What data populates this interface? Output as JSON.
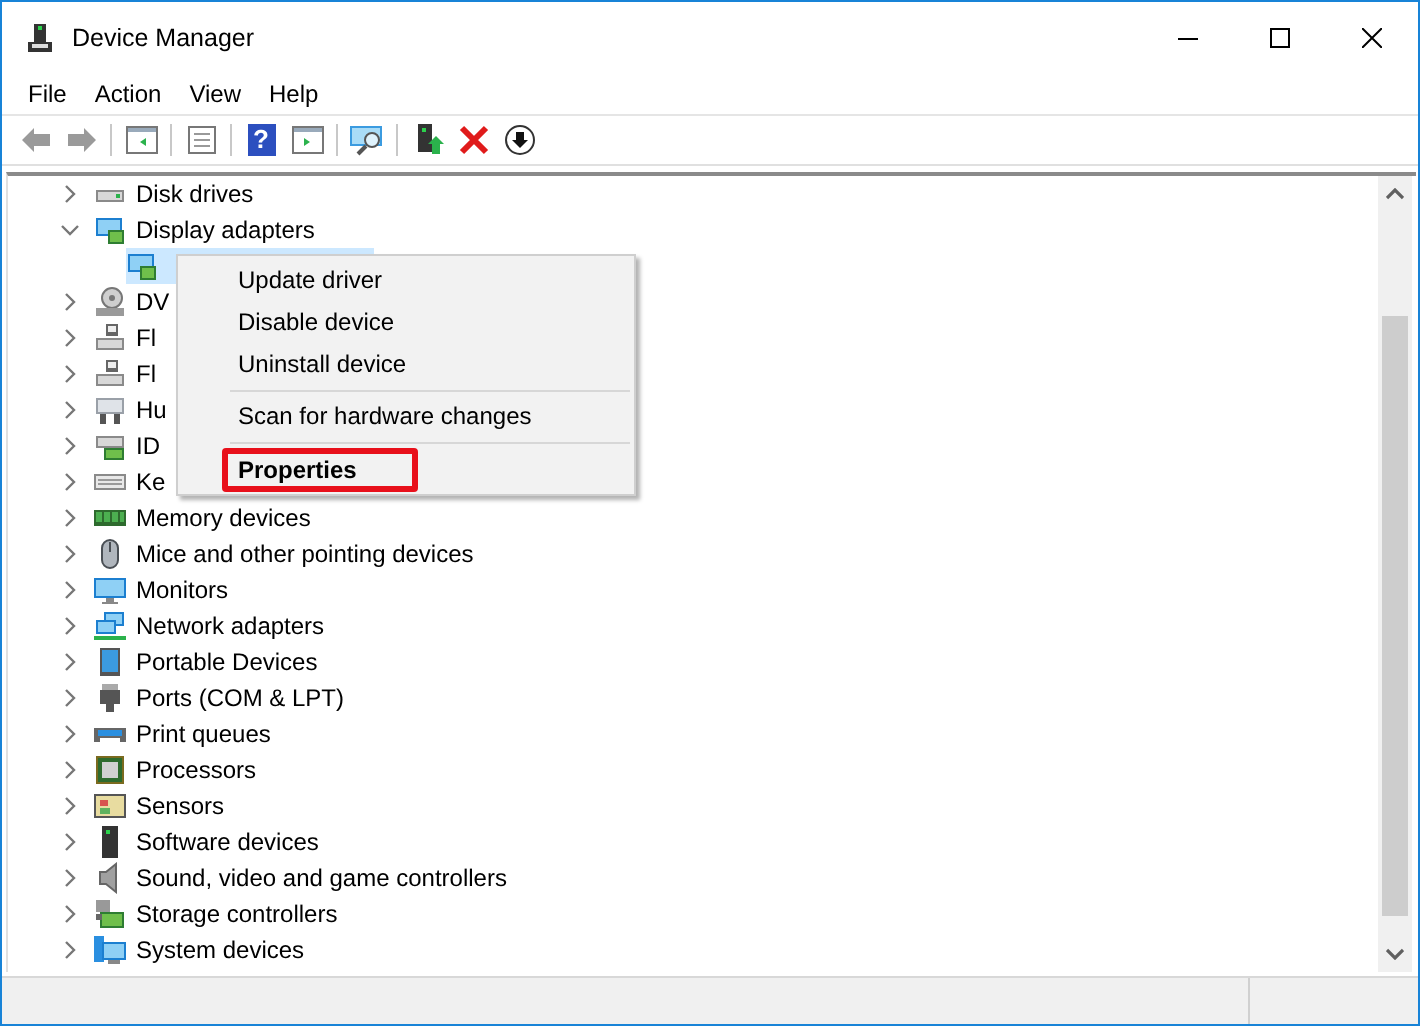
{
  "window": {
    "title": "Device Manager"
  },
  "menu_bar": [
    "File",
    "Action",
    "View",
    "Help"
  ],
  "toolbar": [
    {
      "kind": "back"
    },
    {
      "kind": "forward"
    },
    {
      "kind": "separator"
    },
    {
      "kind": "panel"
    },
    {
      "kind": "separator"
    },
    {
      "kind": "sheet"
    },
    {
      "kind": "separator"
    },
    {
      "kind": "help",
      "glyph": "?"
    },
    {
      "kind": "panel-play"
    },
    {
      "kind": "separator"
    },
    {
      "kind": "scan"
    },
    {
      "kind": "separator"
    },
    {
      "kind": "update"
    },
    {
      "kind": "remove"
    },
    {
      "kind": "down"
    }
  ],
  "tree": {
    "items": [
      {
        "label": "Disk drives",
        "expanded": false,
        "selected": false
      },
      {
        "label": "Display adapters",
        "expanded": true,
        "selected": false,
        "children": [
          {
            "selected": true
          }
        ]
      },
      {
        "label": "DV",
        "expanded": false,
        "selected": false
      },
      {
        "label": "Fl",
        "expanded": false,
        "selected": false
      },
      {
        "label": "Fl",
        "expanded": false,
        "selected": false
      },
      {
        "label": "Hu",
        "expanded": false,
        "selected": false
      },
      {
        "label": "ID",
        "expanded": false,
        "selected": false
      },
      {
        "label": "Ke",
        "expanded": false,
        "selected": false
      },
      {
        "label": "Memory devices",
        "expanded": false,
        "selected": false
      },
      {
        "label": "Mice and other pointing devices",
        "expanded": false,
        "selected": false
      },
      {
        "label": "Monitors",
        "expanded": false,
        "selected": false
      },
      {
        "label": "Network adapters",
        "expanded": false,
        "selected": false
      },
      {
        "label": "Portable Devices",
        "expanded": false,
        "selected": false
      },
      {
        "label": "Ports (COM & LPT)",
        "expanded": false,
        "selected": false
      },
      {
        "label": "Print queues",
        "expanded": false,
        "selected": false
      },
      {
        "label": "Processors",
        "expanded": false,
        "selected": false
      },
      {
        "label": "Sensors",
        "expanded": false,
        "selected": false
      },
      {
        "label": "Software devices",
        "expanded": false,
        "selected": false
      },
      {
        "label": "Sound, video and game controllers",
        "expanded": false,
        "selected": false
      },
      {
        "label": "Storage controllers",
        "expanded": false,
        "selected": false
      },
      {
        "label": "System devices",
        "expanded": false,
        "selected": false
      }
    ]
  },
  "context_menu": {
    "items": [
      {
        "kind": "item",
        "label": "Update driver",
        "default": false,
        "highlighted": false
      },
      {
        "kind": "item",
        "label": "Disable device",
        "default": false,
        "highlighted": false
      },
      {
        "kind": "item",
        "label": "Uninstall device",
        "default": false,
        "highlighted": false
      },
      {
        "kind": "separator"
      },
      {
        "kind": "item",
        "label": "Scan for hardware changes",
        "default": false,
        "highlighted": false
      },
      {
        "kind": "separator"
      },
      {
        "kind": "item",
        "label": "Properties",
        "default": true,
        "highlighted": true
      }
    ]
  }
}
